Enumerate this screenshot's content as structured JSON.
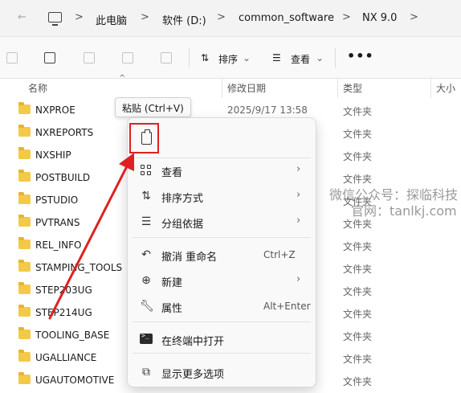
{
  "address_bar": {
    "crumbs": [
      "此电脑",
      "软件 (D:)",
      "common_software",
      "NX 9.0"
    ],
    "separator": ">"
  },
  "toolbar": {
    "sort_label": "排序",
    "view_label": "查看",
    "more_label": "•••"
  },
  "columns": {
    "name": "名称",
    "date": "修改日期",
    "type": "类型",
    "size": "大小"
  },
  "files": [
    {
      "name": "NXPROE",
      "date": "2025/9/17 13:58",
      "type": "文件夹"
    },
    {
      "name": "NXREPORTS",
      "date": "",
      "type": "文件夹"
    },
    {
      "name": "NXSHIP",
      "date": "",
      "type": "文件夹"
    },
    {
      "name": "POSTBUILD",
      "date": "",
      "type": "文件夹"
    },
    {
      "name": "PSTUDIO",
      "date": "",
      "type": "文件夹"
    },
    {
      "name": "PVTRANS",
      "date": "",
      "type": "文件夹"
    },
    {
      "name": "REL_INFO",
      "date": "",
      "type": "文件夹"
    },
    {
      "name": "STAMPING_TOOLS",
      "date": "",
      "type": "文件夹"
    },
    {
      "name": "STEP203UG",
      "date": "",
      "type": "文件夹"
    },
    {
      "name": "STEP214UG",
      "date": "",
      "type": "文件夹"
    },
    {
      "name": "TOOLING_BASE",
      "date": "",
      "type": "文件夹"
    },
    {
      "name": "UGALLIANCE",
      "date": "",
      "type": "文件夹"
    },
    {
      "name": "UGAUTOMOTIVE",
      "date": "",
      "type": "文件夹"
    }
  ],
  "tooltip": "粘贴 (Ctrl+V)",
  "context_menu": {
    "view": "查看",
    "sort": "排序方式",
    "group": "分组依据",
    "undo": "撤消 重命名",
    "undo_shortcut": "Ctrl+Z",
    "new": "新建",
    "properties": "属性",
    "properties_shortcut": "Alt+Enter",
    "terminal": "在终端中打开",
    "more_options": "显示更多选项"
  },
  "watermark": {
    "line1": "微信公众号：探临科技",
    "line2": "官网：tanlkj.com"
  },
  "colors": {
    "annotation_red": "#e02020",
    "folder_yellow": "#f3c94a"
  }
}
